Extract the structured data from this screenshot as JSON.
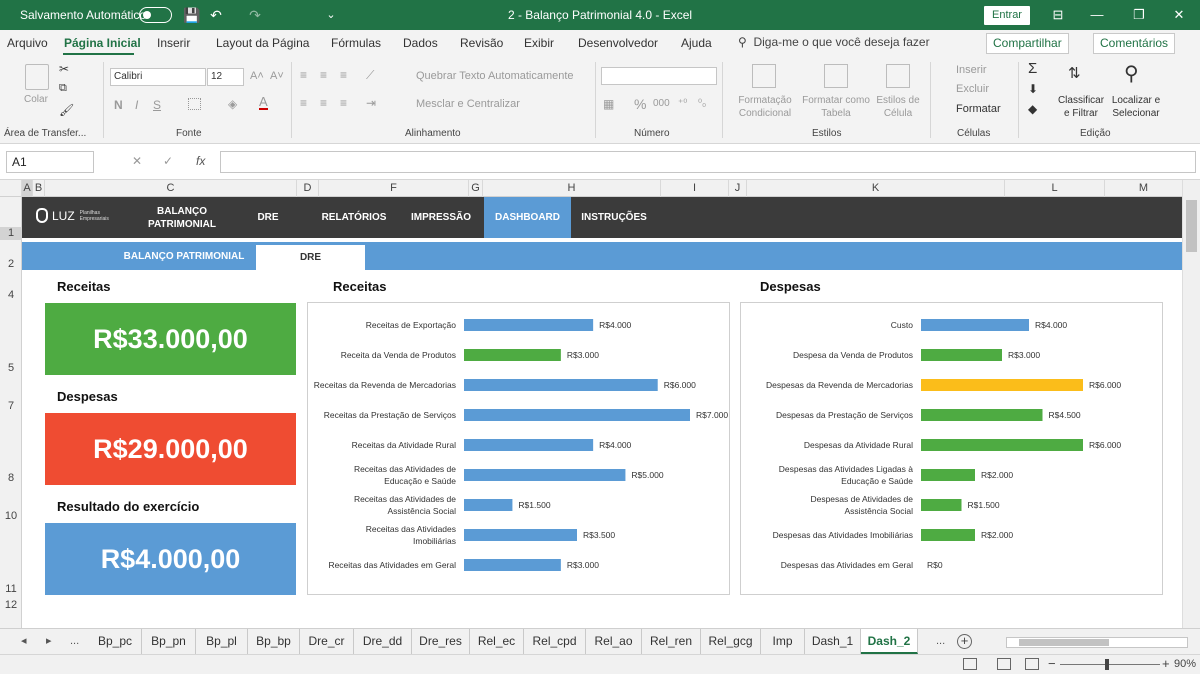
{
  "titlebar": {
    "autosave_label": "Salvamento Automático",
    "title": "2 - Balanço Patrimonial 4.0  -  Excel",
    "signin": "Entrar",
    "minimize": "—",
    "restore": "❐",
    "close": "✕",
    "ribbon_opts": "⊟",
    "qa_save": "💾",
    "qa_undo": "↶",
    "qa_redo": "↷",
    "qa_more": "⌄"
  },
  "menu": {
    "items": [
      "Arquivo",
      "Página Inicial",
      "Inserir",
      "Layout da Página",
      "Fórmulas",
      "Dados",
      "Revisão",
      "Exibir",
      "Desenvolvedor",
      "Ajuda"
    ],
    "search_icon": "⚲",
    "search": "Diga-me o que você deseja fazer",
    "share": "Compartilhar",
    "comments": "Comentários"
  },
  "ribbon": {
    "paste": "Colar",
    "clipboard": "Área de Transfer...",
    "font_name": "Calibri",
    "font_size": "12",
    "font_group": "Fonte",
    "bold": "N",
    "italic": "I",
    "underline": "S",
    "grow": "A˄",
    "shrink": "A˅",
    "wrap": "Quebrar Texto Automaticamente",
    "merge": "Mesclar e Centralizar",
    "align_group": "Alinhamento",
    "number_group": "Número",
    "percent": "%",
    "thousands": "000",
    "cond_format": "Formatação Condicional",
    "format_table": "Formatar como Tabela",
    "cell_styles": "Estilos de Célula",
    "styles_group": "Estilos",
    "insert": "Inserir",
    "delete": "Excluir",
    "format": "Formatar",
    "cells_group": "Células",
    "sum": "Σ",
    "sort_filter": "Classificar e Filtrar",
    "find_select": "Localizar e Selecionar",
    "edit_group": "Edição"
  },
  "formula": {
    "namebox": "A1",
    "cancel": "✕",
    "enter": "✓",
    "fx": "fx"
  },
  "columns": [
    "A",
    "B",
    "C",
    "D",
    "E",
    "F",
    "G",
    "H",
    "I",
    "J",
    "K",
    "L",
    "M"
  ],
  "rows": [
    "1",
    "2",
    "4",
    "5",
    "7",
    "8",
    "10",
    "11",
    "12"
  ],
  "dashboard": {
    "logo": "LUZ",
    "logo_sub": "Planilhas Empresariais",
    "nav": [
      "BALANÇO PATRIMONIAL",
      "DRE",
      "RELATÓRIOS",
      "IMPRESSÃO",
      "DASHBOARD",
      "INSTRUÇÕES"
    ],
    "subnav": [
      "BALANÇO PATRIMONIAL",
      "DRE"
    ],
    "kpis": [
      {
        "title": "Receitas",
        "value": "R$33.000,00",
        "color": "#4eab42"
      },
      {
        "title": "Despesas",
        "value": "R$29.000,00",
        "color": "#ef4c32"
      },
      {
        "title": "Resultado do exercício",
        "value": "R$4.000,00",
        "color": "#5b9bd5"
      }
    ]
  },
  "chart_data": [
    {
      "type": "bar",
      "orientation": "horizontal",
      "title": "Receitas",
      "categories": [
        "Receitas de Exportação",
        "Receita da Venda de Produtos",
        "Receitas da Revenda de Mercadorias",
        "Receitas da Prestação de Serviços",
        "Receitas da Atividade Rural",
        "Receitas das Atividades de Educação e Saúde",
        "Receitas das Atividades de Assistência Social",
        "Receitas das Atividades Imobiliárias",
        "Receitas das Atividades em Geral"
      ],
      "values": [
        4000,
        3000,
        6000,
        7000,
        4000,
        5000,
        1500,
        3500,
        3000
      ],
      "labels": [
        "R$4.000",
        "R$3.000",
        "R$6.000",
        "R$7.000",
        "R$4.000",
        "R$5.000",
        "R$1.500",
        "R$3.500",
        "R$3.000"
      ],
      "colors": [
        "#5b9bd5",
        "#4eab42",
        "#5b9bd5",
        "#5b9bd5",
        "#5b9bd5",
        "#5b9bd5",
        "#5b9bd5",
        "#5b9bd5",
        "#5b9bd5"
      ],
      "xlim": [
        0,
        7000
      ]
    },
    {
      "type": "bar",
      "orientation": "horizontal",
      "title": "Despesas",
      "categories": [
        "Custo",
        "Despesa da Venda de Produtos",
        "Despesas da Revenda de Mercadorias",
        "Despesas da Prestação de Serviços",
        "Despesas da Atividade Rural",
        "Despesas das Atividades Ligadas à Educação e Saúde",
        "Despesas de Atividades de Assistência Social",
        "Despesas das Atividades Imobiliárias",
        "Despesas das Atividades em Geral"
      ],
      "values": [
        4000,
        3000,
        6000,
        4500,
        6000,
        2000,
        1500,
        2000,
        0
      ],
      "labels": [
        "R$4.000",
        "R$3.000",
        "R$6.000",
        "R$4.500",
        "R$6.000",
        "R$2.000",
        "R$1.500",
        "R$2.000",
        "R$0"
      ],
      "colors": [
        "#5b9bd5",
        "#4eab42",
        "#fbbd1a",
        "#4eab42",
        "#4eab42",
        "#4eab42",
        "#4eab42",
        "#4eab42",
        "#4eab42"
      ],
      "xlim": [
        0,
        6000
      ]
    }
  ],
  "sheettabs": {
    "prev": "◂",
    "next": "▸",
    "ellipsis": "...",
    "tabs": [
      "Bp_pc",
      "Bp_pn",
      "Bp_pl",
      "Bp_bp",
      "Dre_cr",
      "Dre_dd",
      "Dre_res",
      "Rel_ec",
      "Rel_cpd",
      "Rel_ao",
      "Rel_ren",
      "Rel_gcg",
      "Imp",
      "Dash_1",
      "Dash_2"
    ],
    "more": "...",
    "add": "+"
  },
  "statusbar": {
    "zoom": "90%",
    "zoom_minus": "−",
    "zoom_plus": "+"
  }
}
